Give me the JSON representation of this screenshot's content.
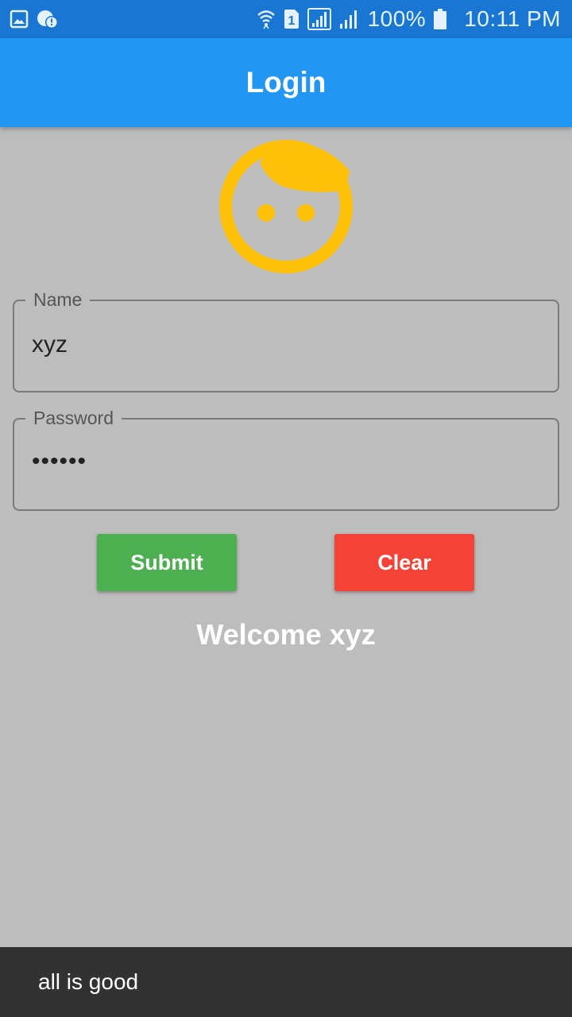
{
  "status_bar": {
    "battery": "100%",
    "time": "10:11 PM",
    "sim_slot": "1",
    "icons": [
      "image-icon",
      "cloud-alert-icon",
      "wifi-icon",
      "sim-icon",
      "signal-icon",
      "signal-icon",
      "battery-icon"
    ]
  },
  "app_bar": {
    "title": "Login"
  },
  "avatar": {
    "icon": "face-icon",
    "color": "#ffc107"
  },
  "form": {
    "name_label": "Name",
    "name_value": "xyz",
    "password_label": "Password",
    "password_value": "••••••"
  },
  "buttons": {
    "submit_label": "Submit",
    "clear_label": "Clear"
  },
  "welcome_text": "Welcome xyz",
  "snackbar": {
    "message": "all is good"
  },
  "colors": {
    "status_bar": "#1976d2",
    "app_bar": "#2196f3",
    "background": "#bdbdbd",
    "submit": "#4caf50",
    "clear": "#f44336",
    "snackbar": "#323232"
  }
}
